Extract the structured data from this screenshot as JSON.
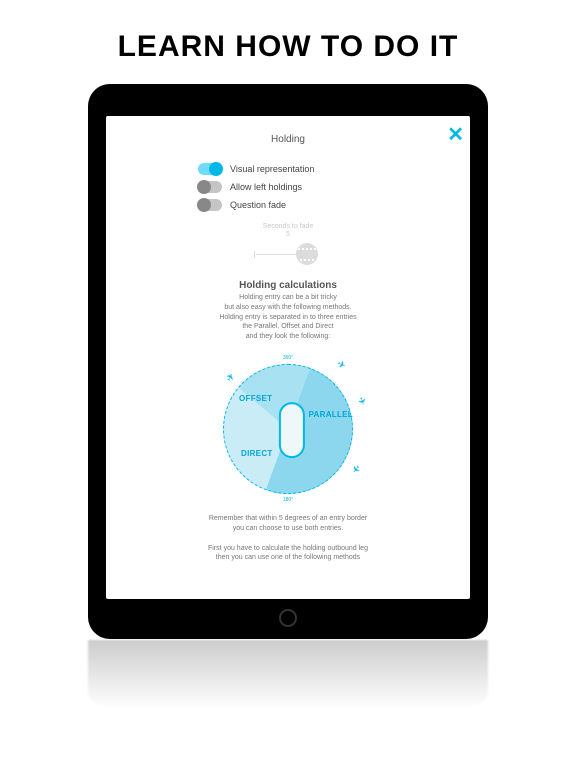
{
  "headline": "LEARN HOW TO DO IT",
  "screen": {
    "close_icon": "✕",
    "title": "Holding",
    "settings": {
      "visual": {
        "label": "Visual representation",
        "on": true
      },
      "left_holdings": {
        "label": "Allow left holdings",
        "on": false
      },
      "question_fade": {
        "label": "Question fade",
        "on": false
      }
    },
    "fade": {
      "caption": "Seconds to fade",
      "value": "5"
    },
    "calc": {
      "title": "Holding calculations",
      "line1": "Holding entry can be a bit tricky",
      "line2": "but also easy with the following methods.",
      "line3": "Holding entry is separated in to three entries",
      "line4": "the Parallel, Offset and Direct",
      "line5": "and they look the following:"
    },
    "diagram": {
      "offset": "OFFSET",
      "parallel": "PARALLEL",
      "direct": "DIRECT",
      "deg_north": "360°",
      "deg_south": "180°"
    },
    "note1a": "Remember that within 5 degrees of an entry border",
    "note1b": "you can choose to use both entries.",
    "note2a": "First you have to calculate the holding outbound leg",
    "note2b": "then you can use one of the following methods"
  }
}
